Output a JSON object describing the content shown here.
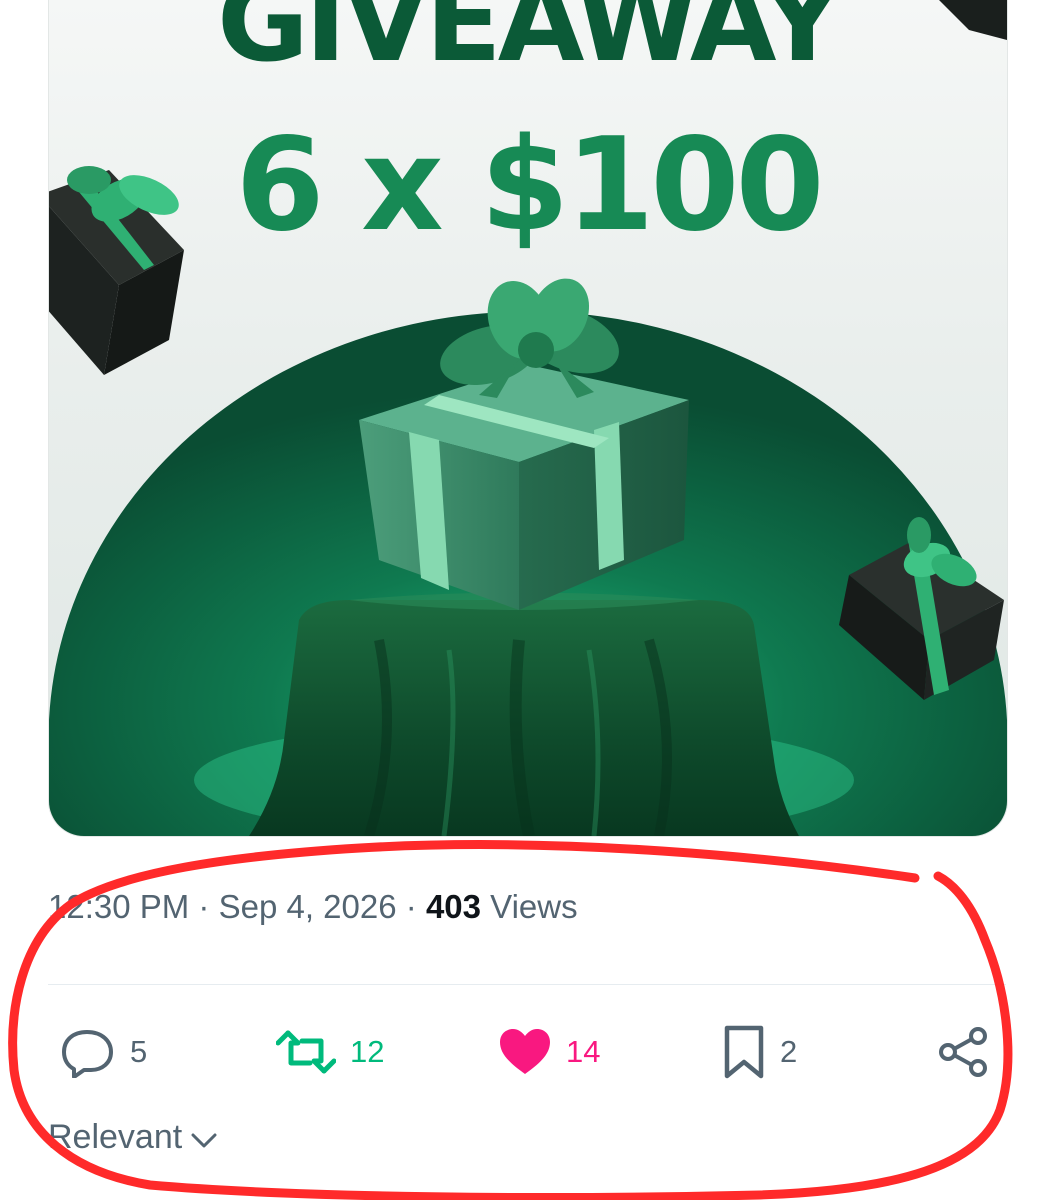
{
  "media": {
    "headline": "GIVEAWAY",
    "amount": "6 x $100"
  },
  "meta": {
    "time": "12:30 PM",
    "separator": "·",
    "date": "Sep 4, 2026",
    "views_count": "403",
    "views_label": "Views"
  },
  "actions": {
    "replies": "5",
    "reposts": "12",
    "likes": "14",
    "bookmarks": "2"
  },
  "sort": {
    "label": "Relevant"
  },
  "colors": {
    "brand_green": "#0b5a37",
    "repost_green": "#00ba7c",
    "like_pink": "#f91880",
    "annotation_red": "#ff2a2a",
    "muted_text": "#536471"
  }
}
